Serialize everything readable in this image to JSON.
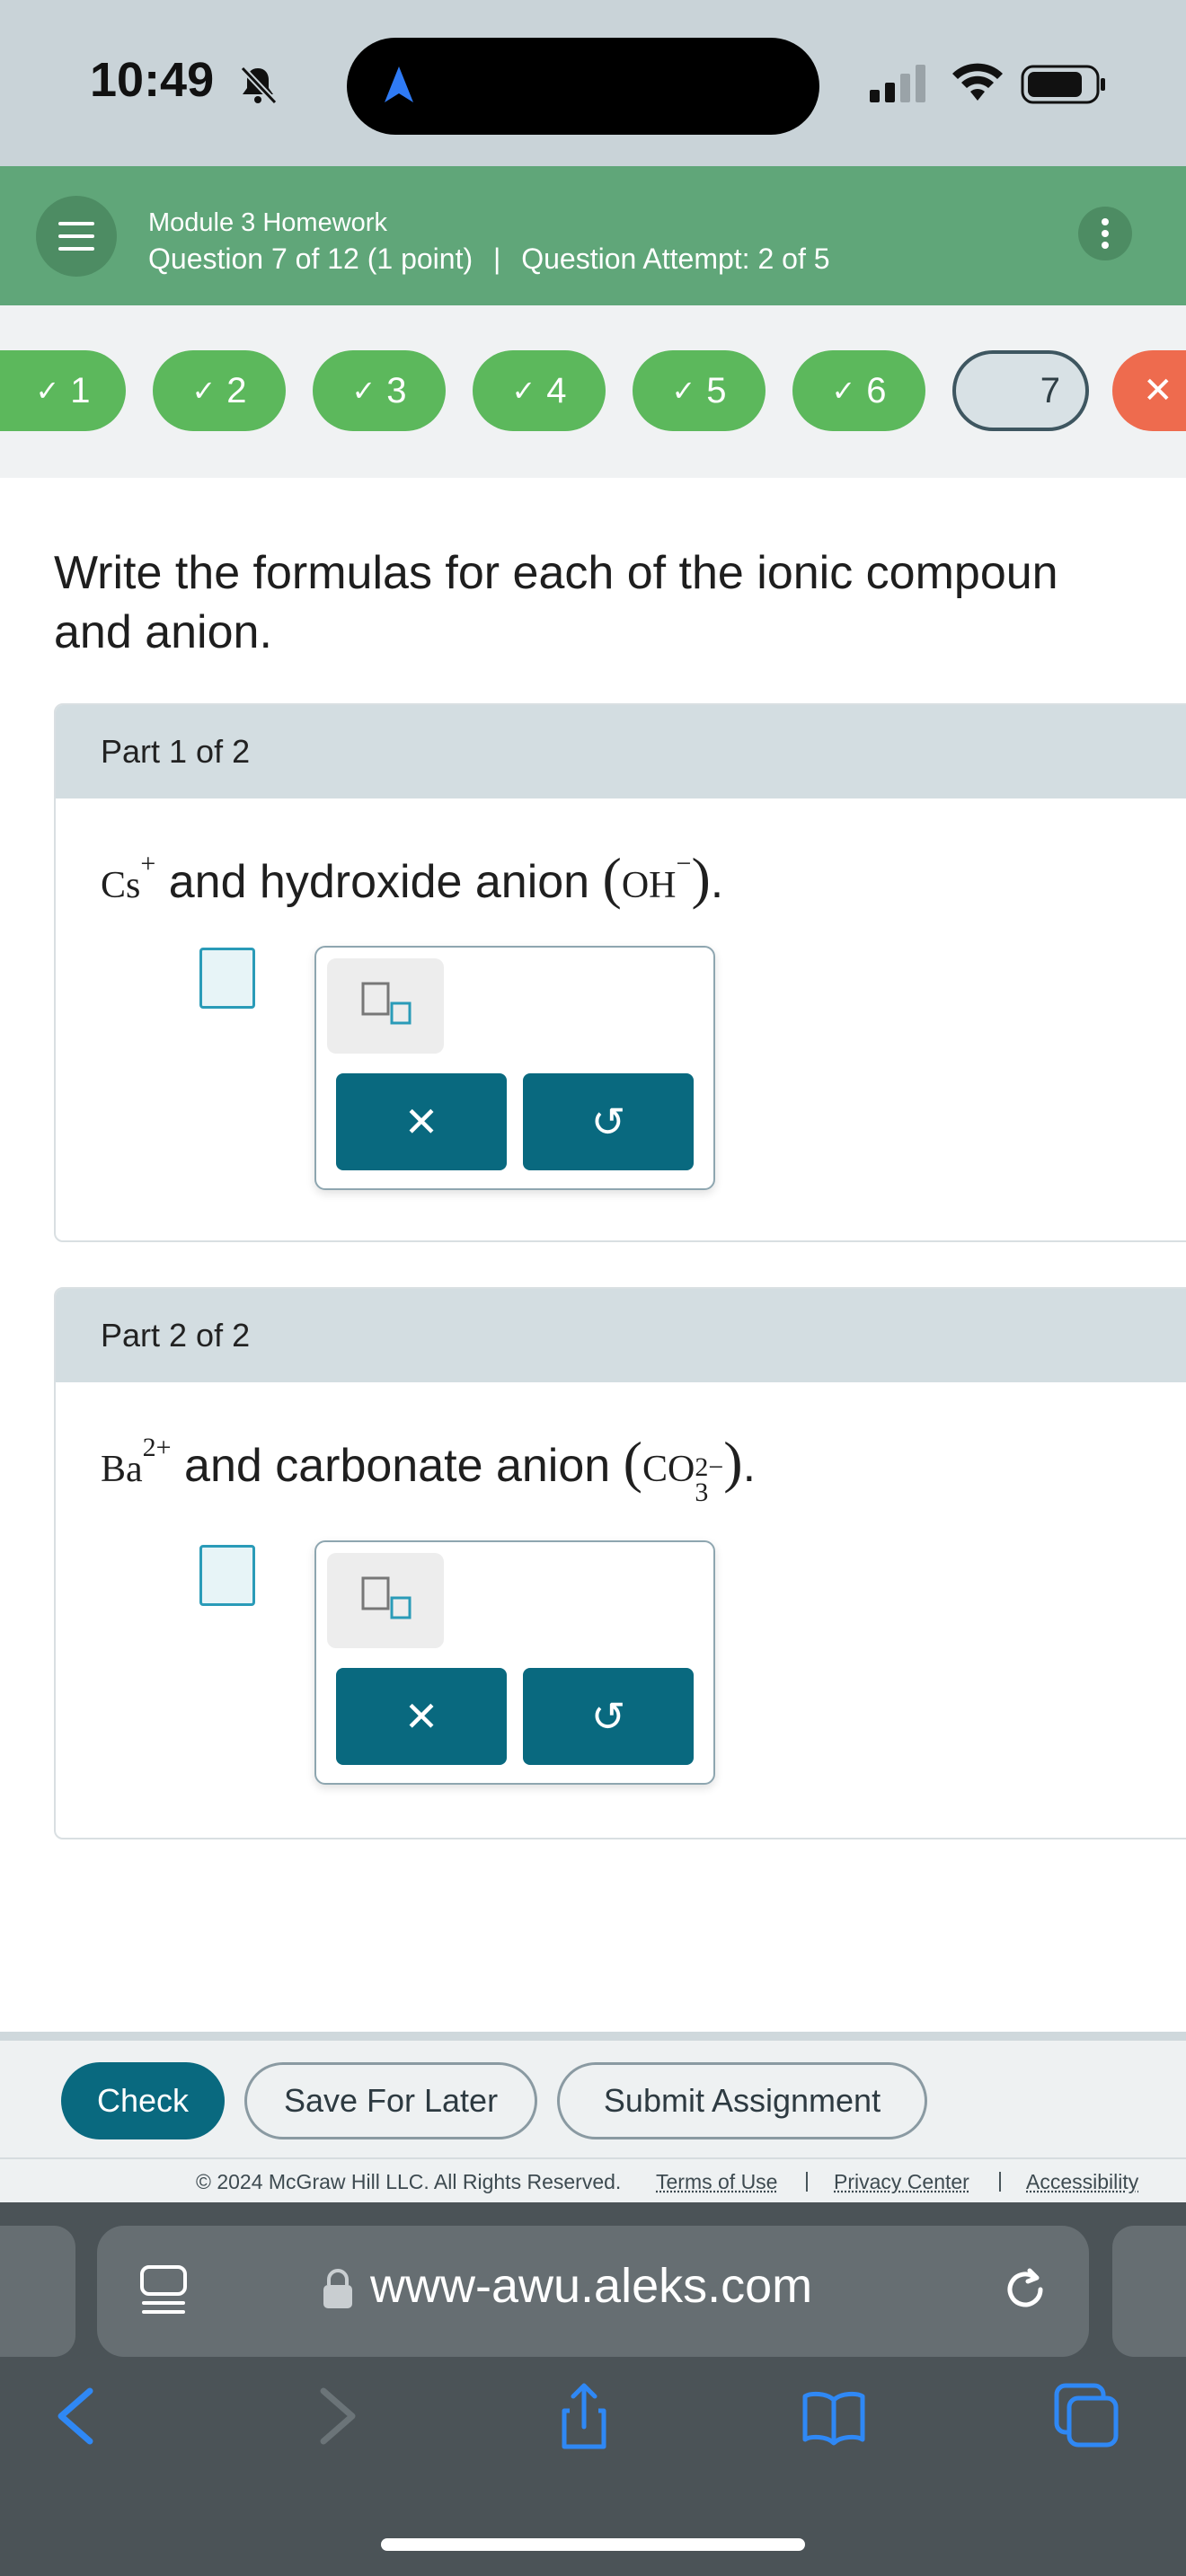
{
  "status_bar": {
    "time": "10:49"
  },
  "header": {
    "module_title": "Module 3 Homework",
    "question_info": "Question 7 of 12 (1 point)",
    "separator": "|",
    "attempt_info": "Question Attempt: 2 of 5"
  },
  "progress": [
    {
      "label": "1",
      "state": "correct"
    },
    {
      "label": "2",
      "state": "correct"
    },
    {
      "label": "3",
      "state": "correct"
    },
    {
      "label": "4",
      "state": "correct"
    },
    {
      "label": "5",
      "state": "correct"
    },
    {
      "label": "6",
      "state": "correct"
    },
    {
      "label": "7",
      "state": "current"
    },
    {
      "label": "✕",
      "state": "incorrect"
    }
  ],
  "check_mark": "✓",
  "prompt": "Write the formulas for each of the ionic compoun",
  "prompt_line2": "and anion.",
  "parts": [
    {
      "title": "Part 1 of 2",
      "cation": "Cs",
      "cation_charge": "+",
      "text": " and hydroxide anion ",
      "anion": "OH",
      "anion_sub": "",
      "anion_charge": "−",
      "end": "."
    },
    {
      "title": "Part 2 of 2",
      "cation": "Ba",
      "cation_charge": "2+",
      "text": " and carbonate anion ",
      "anion": "CO",
      "anion_sub": "3",
      "anion_charge": "2−",
      "end": "."
    }
  ],
  "tools": {
    "clear": "✕",
    "undo": "↺"
  },
  "actions": {
    "check": "Check",
    "save": "Save For Later",
    "submit": "Submit Assignment"
  },
  "footer": {
    "copyright": "© 2024 McGraw Hill LLC. All Rights Reserved.",
    "terms": "Terms of Use",
    "privacy": "Privacy Center",
    "accessibility": "Accessibility",
    "sep": "|"
  },
  "browser": {
    "url": "www-awu.aleks.com"
  },
  "colors": {
    "header": "#60a679",
    "correct": "#5cb85c",
    "incorrect": "#ee6b4e",
    "primary": "#09697f"
  }
}
